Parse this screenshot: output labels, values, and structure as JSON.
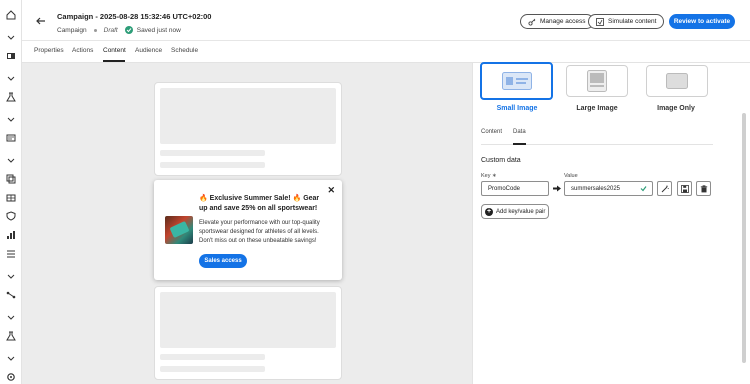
{
  "header": {
    "title": "Campaign - 2025-08-28 15:32:46 UTC+02:00",
    "type": "Campaign",
    "status": "Draft",
    "saved": "Saved just now",
    "manage_access": "Manage access",
    "simulate": "Simulate content",
    "review": "Review to activate"
  },
  "tabs": [
    "Properties",
    "Actions",
    "Content",
    "Audience",
    "Schedule"
  ],
  "popup": {
    "title": "🔥 Exclusive Summer Sale! 🔥 Gear up and save 25% on all sportswear!",
    "body": "Elevate your performance with our top-quality sportswear designed for athletes of all levels. Don't miss out on these unbeatable savings!",
    "button": "Sales access",
    "close": "✕"
  },
  "panel": {
    "layouts": [
      "Small Image",
      "Large Image",
      "Image Only"
    ],
    "selected_layout": "Small Image",
    "subtabs": [
      "Content",
      "Data"
    ],
    "active_subtab": "Data",
    "section_title": "Custom data",
    "key_label": "Key ∗",
    "value_label": "Value",
    "key_value": "PromoCode",
    "value_value": "summersales2025",
    "add_pair": "Add key/value pair"
  },
  "colors": {
    "accent": "#1473e6",
    "success": "#2d9d78",
    "canvas": "#ececec"
  }
}
